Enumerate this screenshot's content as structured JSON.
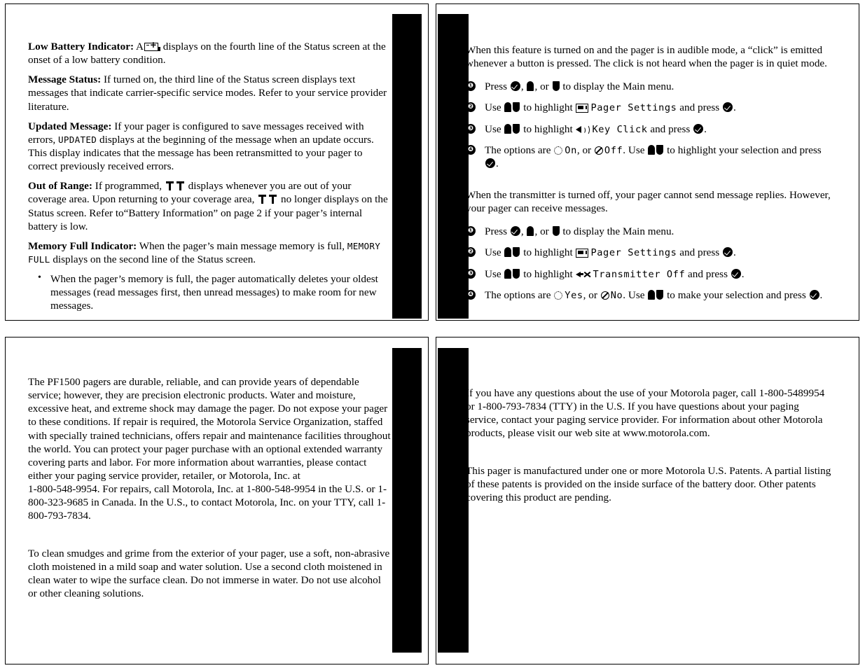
{
  "document": {
    "product": "PF1500",
    "layout": "2x2 manual page spread"
  },
  "page_top_left": {
    "entries": [
      {
        "term": "Low Battery Indicator:",
        "before_icon": " A",
        "icon": "battery-low-icon",
        "after_icon": " displays on the fourth line of the Status screen at the onset of a low battery condition."
      },
      {
        "term": "Message Status:",
        "body": " If turned on, the third line of the Status screen displays text messages that indicate carrier-specific service modes. Refer to your service provider literature."
      },
      {
        "term": "Updated Message:",
        "part1": " If your pager is configured to save messages received with errors, ",
        "lcd": "UPDATED",
        "part2": " displays at the beginning of the message when an update occurs. This display indicates that the message has been retransmitted to your pager to correct previously received errors."
      },
      {
        "term": "Out of Range:",
        "part1": " If programmed, ",
        "icon1": "antenna-out-of-range-icon",
        "part2": " displays whenever you are out of your coverage area. Upon returning to your coverage area, ",
        "icon2": "antenna-out-of-range-icon",
        "part3": " no longer displays on the Status screen. Refer to“Battery Information” on page 2 if your pager’s internal battery is low."
      },
      {
        "term": "Memory Full Indicator:",
        "part1": " When the pager’s main message memory is full, ",
        "lcd": "MEMORY FULL",
        "part2": " displays on the second line of the Status screen."
      }
    ],
    "bullets": [
      "When the pager’s memory is full, the pager automatically deletes your oldest messages (read messages first, then unread messages) to make room for new messages."
    ]
  },
  "page_top_right": {
    "section_key_click": {
      "intro": "When this feature is turned on and the pager is in audible mode, a “click” is emitted whenever a button is pressed. The click is not heard when the pager is in quiet mode.",
      "steps": [
        {
          "num": "❶",
          "t1": "Press ",
          "icon_select": "select-button-icon",
          "t2": ", ",
          "icon_up": "up-button-icon",
          "t3": ", or ",
          "icon_down": "down-button-icon",
          "t4": " to display the Main menu."
        },
        {
          "num": "❷",
          "t1": "Use ",
          "icon_updown": "up-down-button-icon",
          "t2": " to highlight ",
          "menu_icon": "pager-settings-icon",
          "lcd": "Pager Settings",
          "t3": " and press ",
          "icon_select": "select-button-icon",
          "t4": "."
        },
        {
          "num": "❸",
          "t1": "Use ",
          "icon_updown": "up-down-button-icon",
          "t2": " to highlight ",
          "menu_icon": "key-click-speaker-icon",
          "lcd": "Key Click",
          "t3": " and press ",
          "icon_select": "select-button-icon",
          "t4": "."
        },
        {
          "num": "❹",
          "t1": "The options are ",
          "opt_on_icon": "radio-on-icon",
          "opt_on": "On",
          "t2": ", or ",
          "opt_off_icon": "radio-off-icon",
          "opt_off": "Off",
          "t3": ". Use ",
          "icon_updown": "up-down-button-icon",
          "t4": " to highlight your selection and press ",
          "icon_select": "select-button-icon",
          "t5": "."
        }
      ]
    },
    "section_transmitter_off": {
      "intro": "When the transmitter is turned off, your pager cannot send message replies. However, your pager can receive messages.",
      "steps": [
        {
          "num": "❶",
          "t1": "Press ",
          "icon_select": "select-button-icon",
          "t2": ", ",
          "icon_up": "up-button-icon",
          "t3": ", or ",
          "icon_down": "down-button-icon",
          "t4": " to display the Main menu."
        },
        {
          "num": "❷",
          "t1": "Use ",
          "icon_updown": "up-down-button-icon",
          "t2": " to highlight ",
          "menu_icon": "pager-settings-icon",
          "lcd": "Pager Settings",
          "t3": " and press ",
          "icon_select": "select-button-icon",
          "t4": "."
        },
        {
          "num": "❸",
          "t1": "Use ",
          "icon_updown": "up-down-button-icon",
          "t2": " to highlight ",
          "menu_icon": "transmitter-off-icon",
          "lcd": "Transmitter Off",
          "t3": " and press ",
          "icon_select": "select-button-icon",
          "t4": "."
        },
        {
          "num": "❹",
          "t1": "The options are ",
          "opt_on_icon": "radio-on-icon",
          "opt_on": "Yes",
          "t2": ", or ",
          "opt_off_icon": "radio-off-icon",
          "opt_off": "No",
          "t3": ". Use ",
          "icon_updown": "up-down-button-icon",
          "t4": " to make your selection and press ",
          "icon_select": "select-button-icon",
          "t5": "."
        }
      ]
    }
  },
  "page_bottom_left": {
    "paragraphs": [
      "The PF1500 pagers are durable, reliable, and can provide years of dependable service; however, they are precision electronic products. Water and moisture, excessive heat, and extreme shock may damage the pager. Do not expose your pager to these conditions. If repair is required, the Motorola Service Organization, staffed with specially trained technicians, offers repair and maintenance facilities throughout the world. You can protect your pager purchase with an optional extended warranty covering parts and labor. For more information about warranties, please contact either your paging service provider, retailer, or Motorola, Inc. at",
      "1-800-548-9954. For repairs, call Motorola, Inc. at 1-800-548-9954 in the U.S. or 1-800-323-9685 in Canada. In the U.S., to contact Motorola, Inc. on your TTY, call 1-800-793-7834.",
      "To clean smudges and grime from the exterior of your pager, use a soft, non-abrasive cloth moistened in a mild soap and water solution. Use a second cloth moistened in clean water to wipe the surface clean. Do not immerse in water. Do not use alcohol or other cleaning solutions."
    ]
  },
  "page_bottom_right": {
    "paragraphs": [
      "If you have any questions about the use of your Motorola pager, call 1-800-5489954 or 1-800-793-7834 (TTY) in the U.S. If you have questions about your paging service, contact your paging service provider. For information about other Motorola products, please visit our web site at www.motorola.com.",
      "This pager is manufactured under one or more Motorola U.S. Patents. A partial listing of these patents is provided on the inside surface of the battery door. Other patents covering this product are pending."
    ]
  }
}
